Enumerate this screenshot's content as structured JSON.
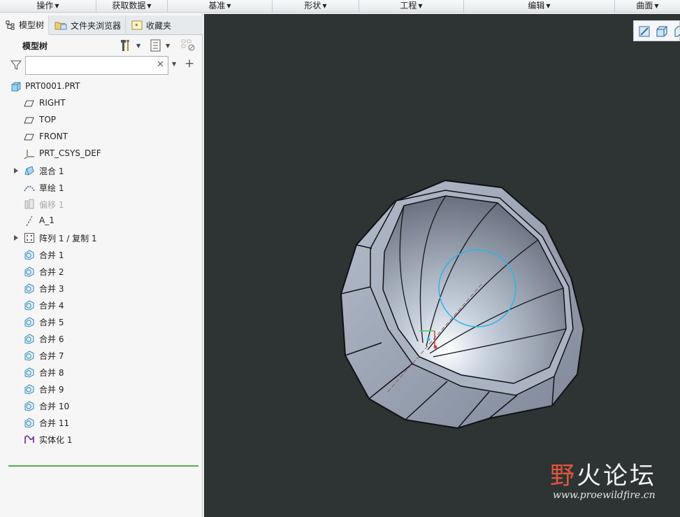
{
  "ribbon_groups": [
    {
      "label": "操作"
    },
    {
      "label": "获取数据"
    },
    {
      "label": "基准"
    },
    {
      "label": "形状"
    },
    {
      "label": "工程"
    },
    {
      "label": "编辑"
    },
    {
      "label": "曲面"
    }
  ],
  "tabs": [
    {
      "label": "模型树",
      "icon": "model-tree-icon"
    },
    {
      "label": "文件夹浏览器",
      "icon": "folder-browser-icon"
    },
    {
      "label": "收藏夹",
      "icon": "favorites-icon"
    }
  ],
  "model_tree": {
    "title": "模型树",
    "search_value": "",
    "items": [
      {
        "label": "PRT0001.PRT",
        "icon": "part-icon"
      },
      {
        "label": "RIGHT",
        "icon": "datum-plane-icon"
      },
      {
        "label": "TOP",
        "icon": "datum-plane-icon"
      },
      {
        "label": "FRONT",
        "icon": "datum-plane-icon"
      },
      {
        "label": "PRT_CSYS_DEF",
        "icon": "csys-icon"
      },
      {
        "label": "混合 1",
        "icon": "blend-icon"
      },
      {
        "label": "草绘 1",
        "icon": "sketch-icon"
      },
      {
        "label": "偏移 1",
        "icon": "offset-icon"
      },
      {
        "label": "A_1",
        "icon": "axis-icon"
      },
      {
        "label": "阵列 1 / 复制 1",
        "icon": "pattern-icon"
      },
      {
        "label": "合并 1",
        "icon": "merge-icon"
      },
      {
        "label": "合并 2",
        "icon": "merge-icon"
      },
      {
        "label": "合并 3",
        "icon": "merge-icon"
      },
      {
        "label": "合并 4",
        "icon": "merge-icon"
      },
      {
        "label": "合并 5",
        "icon": "merge-icon"
      },
      {
        "label": "合并 6",
        "icon": "merge-icon"
      },
      {
        "label": "合并 7",
        "icon": "merge-icon"
      },
      {
        "label": "合并 8",
        "icon": "merge-icon"
      },
      {
        "label": "合并 9",
        "icon": "merge-icon"
      },
      {
        "label": "合并 10",
        "icon": "merge-icon"
      },
      {
        "label": "合并 11",
        "icon": "merge-icon"
      },
      {
        "label": "实体化 1",
        "icon": "solidify-icon"
      }
    ]
  },
  "watermark": {
    "title_red": "野",
    "title_rest": "火论坛",
    "url": "www.proewildfire.cn"
  },
  "colors": {
    "background": "#2e3333",
    "model_fill": "#9aa3b3",
    "sketch_circle": "#27b6e8",
    "insert_line": "#55b14a"
  }
}
